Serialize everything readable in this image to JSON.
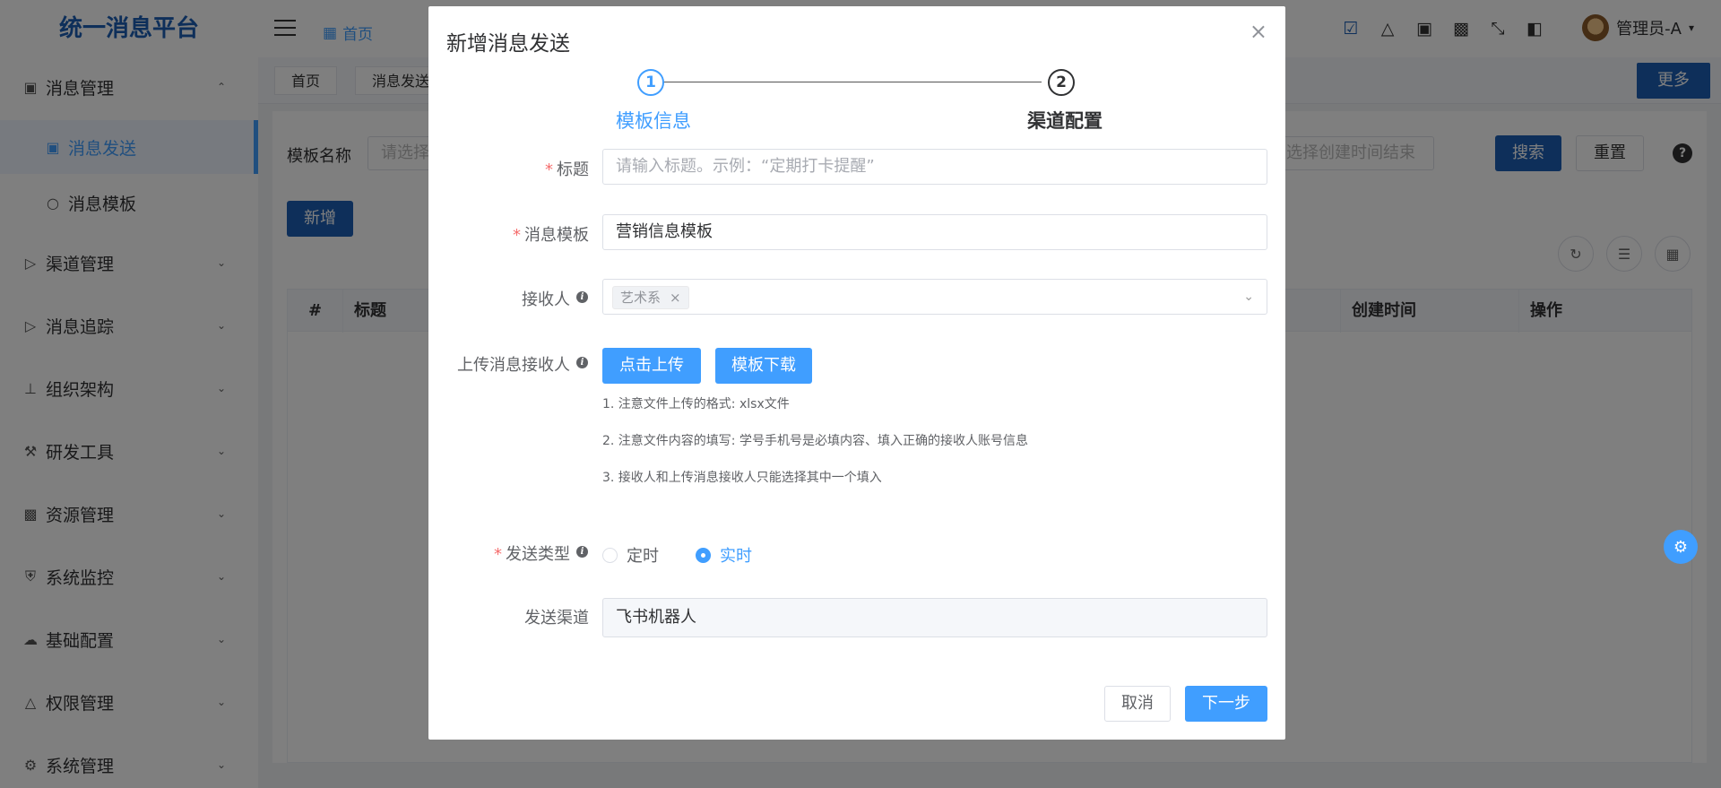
{
  "app": {
    "title": "统一消息平台"
  },
  "sidebar": {
    "items": [
      {
        "label": "消息管理",
        "icon": "message-icon",
        "arrow": "up"
      },
      {
        "label": "消息发送",
        "icon": "message-icon",
        "sub": true,
        "active": true
      },
      {
        "label": "消息模板",
        "icon": "circle-icon",
        "sub": true
      },
      {
        "label": "渠道管理",
        "icon": "send-icon",
        "arrow": "down"
      },
      {
        "label": "消息追踪",
        "icon": "send-icon",
        "arrow": "down"
      },
      {
        "label": "组织架构",
        "icon": "org-icon",
        "arrow": "down"
      },
      {
        "label": "研发工具",
        "icon": "wrench-icon",
        "arrow": "down"
      },
      {
        "label": "资源管理",
        "icon": "wallet-icon",
        "arrow": "down"
      },
      {
        "label": "系统监控",
        "icon": "shield-icon",
        "arrow": "down"
      },
      {
        "label": "基础配置",
        "icon": "cloud-icon",
        "arrow": "down"
      },
      {
        "label": "权限管理",
        "icon": "lock-icon",
        "arrow": "down"
      },
      {
        "label": "系统管理",
        "icon": "gear-icon",
        "arrow": "down"
      }
    ]
  },
  "header": {
    "breadcrumb": "首页",
    "user": "管理员-A"
  },
  "tabs": {
    "items": [
      "首页",
      "消息发送"
    ],
    "more": "更多"
  },
  "content": {
    "filter_label": "模板名称",
    "filter_placeholder": "请选择模板",
    "date_placeholder": "选择创建时间结束",
    "search": "搜索",
    "reset": "重置",
    "add": "新增",
    "columns": [
      "#",
      "标题",
      "创建时间",
      "操作"
    ]
  },
  "dialog": {
    "title": "新增消息发送",
    "steps": [
      {
        "num": "1",
        "title": "模板信息"
      },
      {
        "num": "2",
        "title": "渠道配置"
      }
    ],
    "fields": {
      "title_label": "标题",
      "title_placeholder": "请输入标题。示例：“定期打卡提醒”",
      "template_label": "消息模板",
      "template_value": "营销信息模板",
      "receiver_label": "接收人",
      "receiver_tag": "艺术系",
      "upload_label": "上传消息接收人",
      "upload_button": "点击上传",
      "download_button": "模板下载",
      "notes": [
        "1. 注意文件上传的格式: xlsx文件",
        "2. 注意文件内容的填写: 学号手机号是必填内容、填入正确的接收人账号信息",
        "3. 接收人和上传消息接收人只能选择其中一个填入"
      ],
      "send_type_label": "发送类型",
      "send_type_options": [
        "定时",
        "实时"
      ],
      "send_type_selected": "实时",
      "channel_label": "发送渠道",
      "channel_value": "飞书机器人"
    },
    "footer": {
      "cancel": "取消",
      "next": "下一步"
    }
  }
}
